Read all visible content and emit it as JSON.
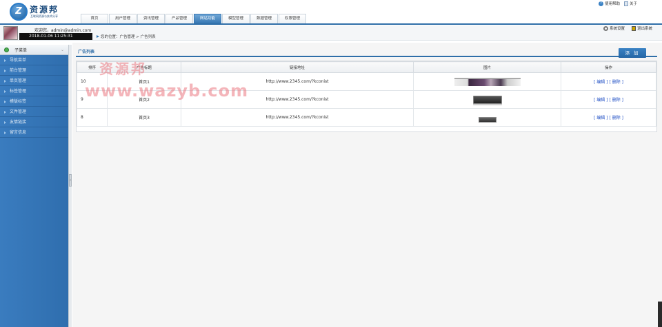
{
  "logo": {
    "mark": "Z",
    "title": "资源邦",
    "subtitle": "互联网资源与技术分享"
  },
  "nav": {
    "items": [
      "首页",
      "用户管理",
      "资讯管理",
      "产品管理",
      "网站功能",
      "模型管理",
      "数据管理",
      "权限管理"
    ],
    "active_index": 4
  },
  "top_links": {
    "help": "使用帮助",
    "about": "关于"
  },
  "user": {
    "welcome": "欢迎您，admin@admin.com",
    "datetime": "2018-01-06 11:25:31"
  },
  "breadcrumb": "您的位置：广告管理 > 广告列表",
  "sys_links": {
    "settings": "系统设置",
    "logout": "退出系统"
  },
  "sidebar": {
    "header": "子菜单",
    "items": [
      "导航菜单",
      "前台管理",
      "单页管理",
      "标签管理",
      "模版标签",
      "文件管理",
      "友情链接",
      "留言信息"
    ]
  },
  "main": {
    "tab": "广告列表",
    "add_button": "添 加",
    "columns": [
      "排序",
      "广告标题",
      "链接地址",
      "图片",
      "操作"
    ],
    "rows": [
      {
        "sort": "10",
        "title": "首页1",
        "url": "http://www.2345.com/?kconist",
        "thumb": "t1"
      },
      {
        "sort": "9",
        "title": "首页2",
        "url": "http://www.2345.com/?kconist",
        "thumb": "t2"
      },
      {
        "sort": "8",
        "title": "首页3",
        "url": "http://www.2345.com/?kconist",
        "thumb": "t3"
      }
    ],
    "edit_label": "[ 编辑 ]",
    "delete_label": "[ 删除 ]"
  },
  "watermark": {
    "line1": "资源邦",
    "line2": "www.wazyb.com"
  },
  "colors": {
    "accent": "#2f6ea8",
    "sidebar": "#3a7cbf",
    "link": "#1f4fc5"
  }
}
